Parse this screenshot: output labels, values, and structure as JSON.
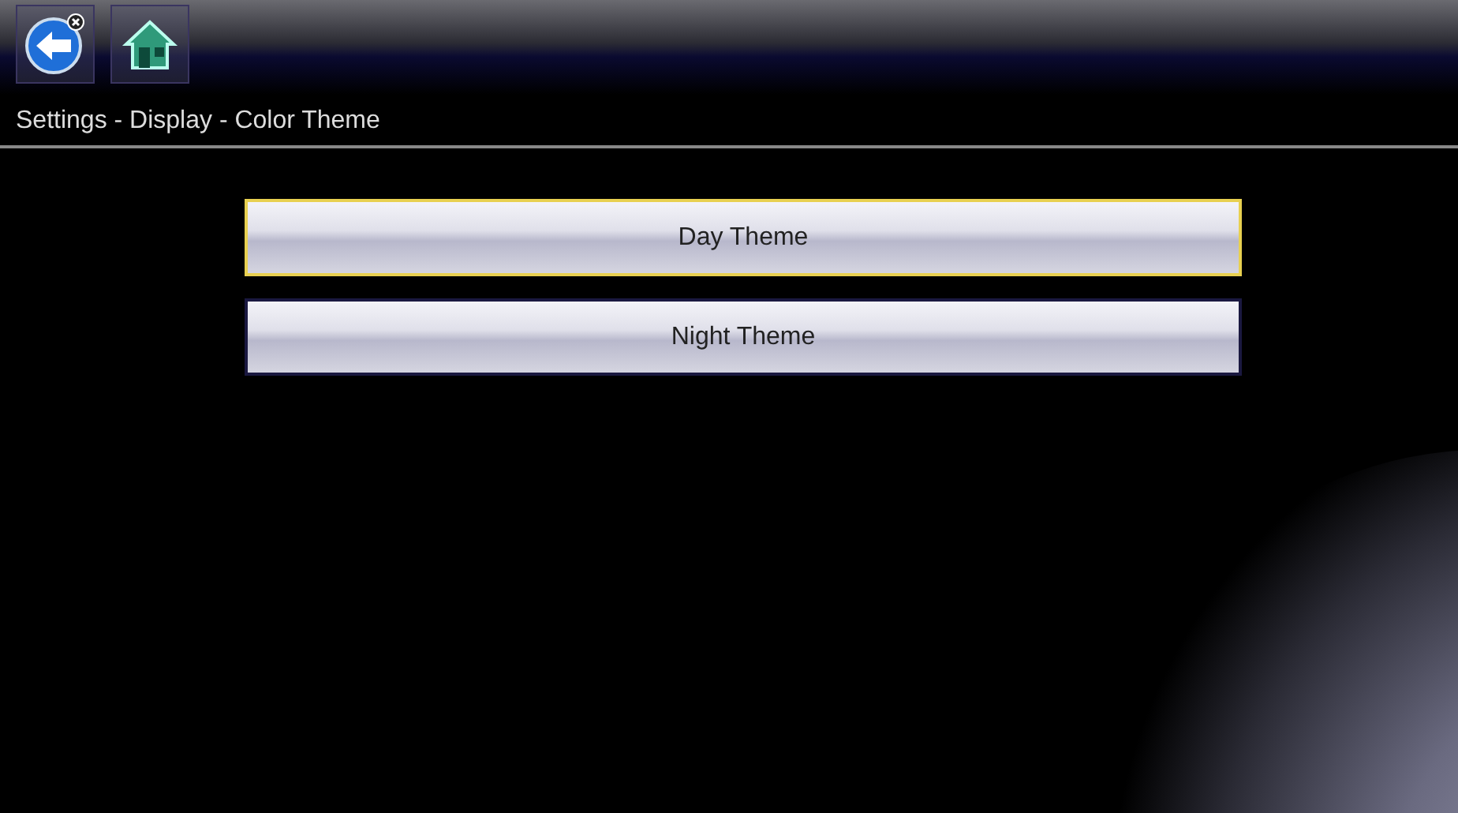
{
  "toolbar": {
    "buttons": [
      {
        "kind": "back"
      },
      {
        "kind": "home"
      }
    ]
  },
  "breadcrumb": "Settings - Display - Color Theme",
  "options": [
    {
      "label": "Day Theme",
      "selected": true
    },
    {
      "label": "Night Theme",
      "selected": false
    }
  ]
}
